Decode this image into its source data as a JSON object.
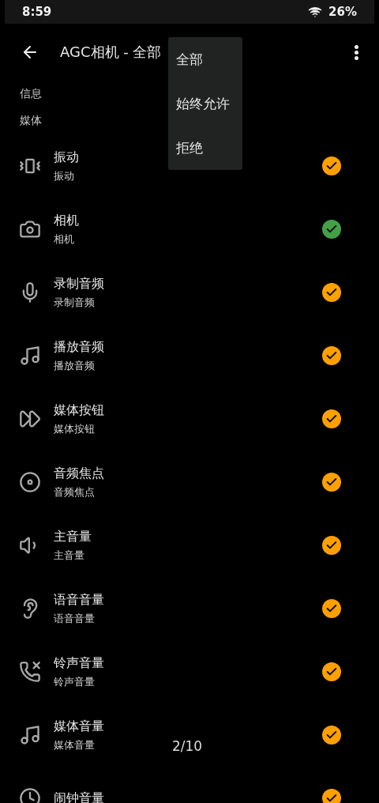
{
  "status_bar": {
    "time": "8:59",
    "battery": "26%"
  },
  "app_bar": {
    "title": "AGC相机 - 全部"
  },
  "sections": [
    "信息",
    "媒体"
  ],
  "permissions": [
    {
      "title": "振动",
      "subtitle": "振动",
      "color": "#ffa000"
    },
    {
      "title": "相机",
      "subtitle": "相机",
      "color": "#43a047"
    },
    {
      "title": "录制音频",
      "subtitle": "录制音频",
      "color": "#ffa000"
    },
    {
      "title": "播放音频",
      "subtitle": "播放音频",
      "color": "#ffa000"
    },
    {
      "title": "媒体按钮",
      "subtitle": "媒体按钮",
      "color": "#ffa000"
    },
    {
      "title": "音频焦点",
      "subtitle": "音频焦点",
      "color": "#ffa000"
    },
    {
      "title": "主音量",
      "subtitle": "主音量",
      "color": "#ffa000"
    },
    {
      "title": "语音音量",
      "subtitle": "语音音量",
      "color": "#ffa000"
    },
    {
      "title": "铃声音量",
      "subtitle": "铃声音量",
      "color": "#ffa000"
    },
    {
      "title": "媒体音量",
      "subtitle": "媒体音量",
      "color": "#ffa000"
    },
    {
      "title": "闹钟音量",
      "color": "#ffa000"
    }
  ],
  "filter_menu": {
    "items": [
      "全部",
      "始终允许",
      "拒绝"
    ]
  },
  "page_indicator": "2/10"
}
